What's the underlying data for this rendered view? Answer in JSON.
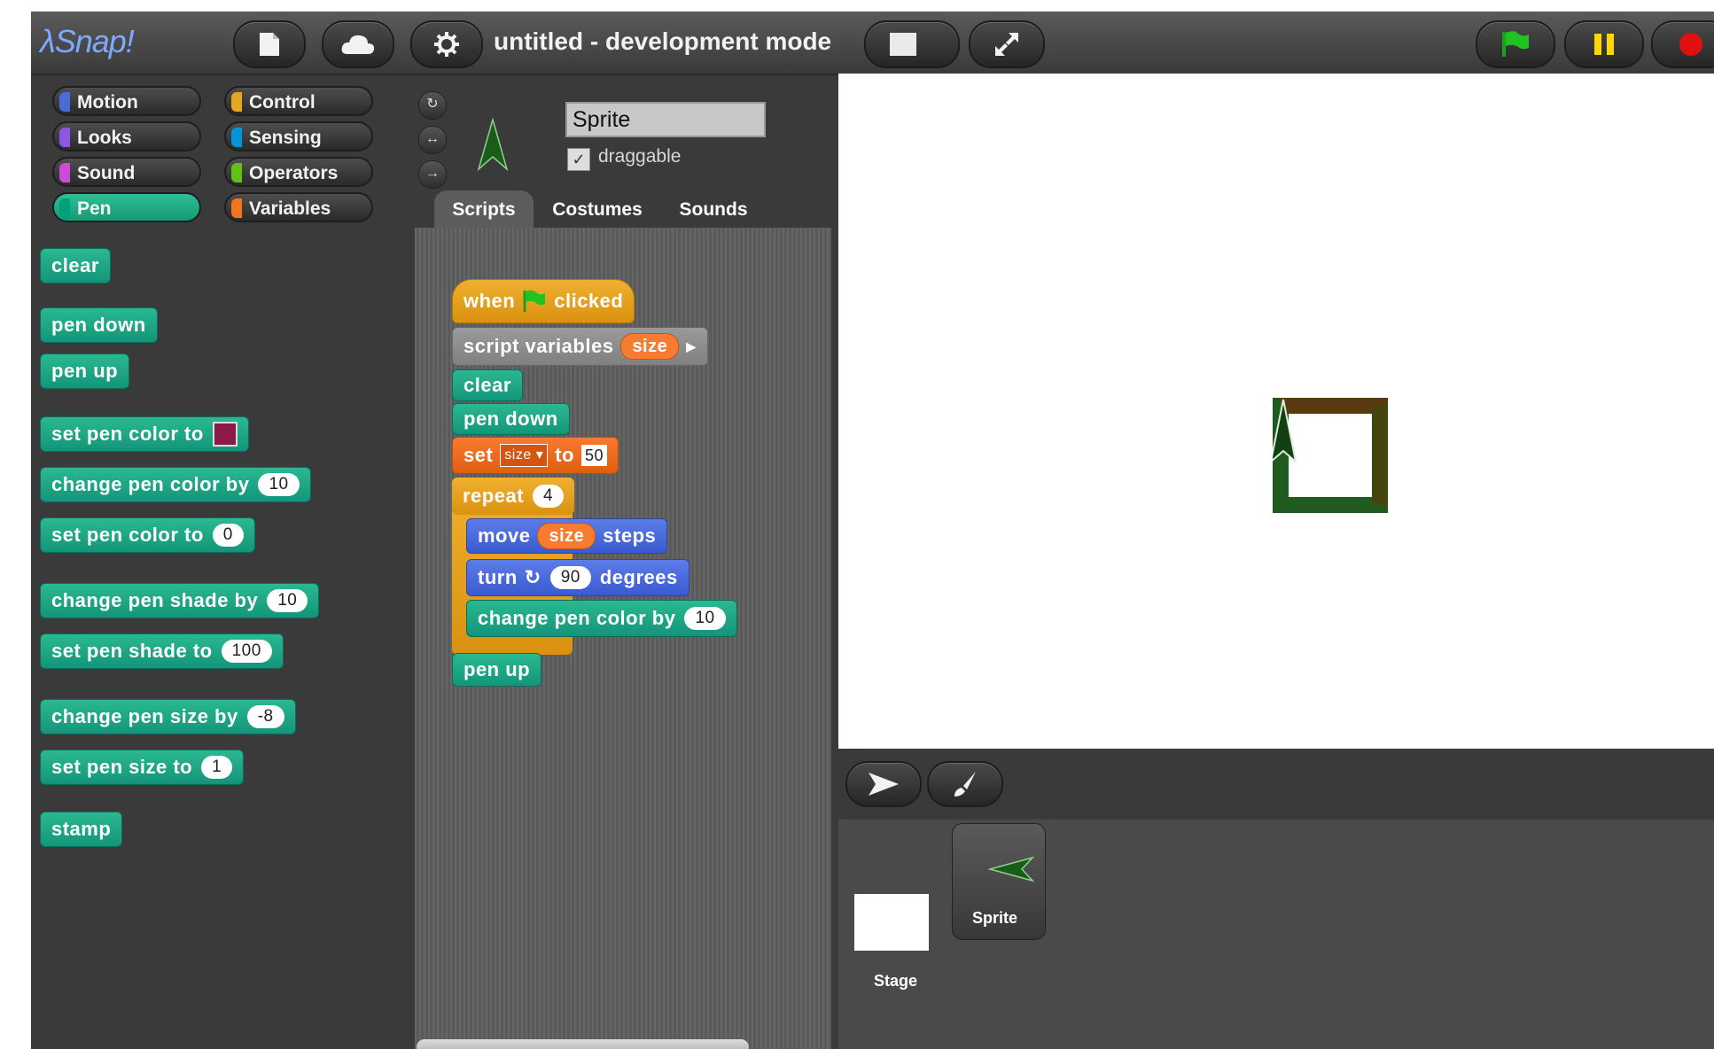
{
  "topbar": {
    "logo": "λSnap!",
    "project_title": "untitled - development mode"
  },
  "palette": {
    "categories": [
      {
        "label": "Motion",
        "color": "#4a6cd4"
      },
      {
        "label": "Control",
        "color": "#e6a822"
      },
      {
        "label": "Looks",
        "color": "#8f56e3"
      },
      {
        "label": "Sensing",
        "color": "#0494dc"
      },
      {
        "label": "Sound",
        "color": "#cf4ad9"
      },
      {
        "label": "Operators",
        "color": "#62c213"
      },
      {
        "label": "Pen",
        "color": "#00a178",
        "selected": true
      },
      {
        "label": "Variables",
        "color": "#f3761d"
      }
    ],
    "blocks": {
      "clear": "clear",
      "pen_down": "pen down",
      "pen_up": "pen up",
      "set_pen_color_swatch": "set pen color to",
      "change_pen_color": {
        "label": "change pen color by",
        "value": "10"
      },
      "set_pen_color_num": {
        "label": "set pen color to",
        "value": "0"
      },
      "change_pen_shade": {
        "label": "change pen shade by",
        "value": "10"
      },
      "set_pen_shade": {
        "label": "set pen shade to",
        "value": "100"
      },
      "change_pen_size": {
        "label": "change pen size by",
        "value": "-8"
      },
      "set_pen_size": {
        "label": "set pen size to",
        "value": "1"
      },
      "stamp": "stamp"
    }
  },
  "sprite": {
    "name": "Sprite",
    "draggable_label": "draggable",
    "draggable_checked": true,
    "tabs": [
      "Scripts",
      "Costumes",
      "Sounds"
    ]
  },
  "script": {
    "hat_when": "when",
    "hat_clicked": "clicked",
    "script_variables": "script variables",
    "var_name": "size",
    "clear": "clear",
    "pen_down": "pen down",
    "set_label": "set",
    "set_var": "size",
    "set_to": "to",
    "set_value": "50",
    "repeat_label": "repeat",
    "repeat_value": "4",
    "move_label": "move",
    "move_var": "size",
    "move_steps": "steps",
    "turn_label": "turn",
    "turn_value": "90",
    "turn_degrees": "degrees",
    "change_color_label": "change pen color by",
    "change_color_value": "10",
    "pen_up": "pen up"
  },
  "corral": {
    "stage_label": "Stage",
    "sprite_label": "Sprite"
  }
}
